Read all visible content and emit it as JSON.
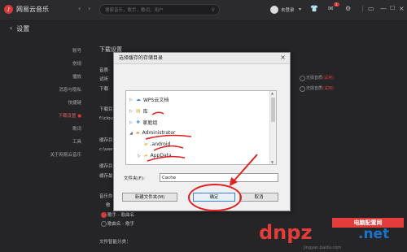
{
  "app": {
    "logo": "网易云音乐"
  },
  "header": {
    "search_placeholder": "搜索音乐，歌手，歌词，用户",
    "user": "未登录"
  },
  "page": {
    "title": "设置"
  },
  "sidebar": {
    "items": [
      {
        "label": "账号",
        "active": false
      },
      {
        "label": "常规",
        "active": false
      },
      {
        "label": "播放",
        "active": false
      },
      {
        "label": "消息与隐私",
        "active": false
      },
      {
        "label": "快捷键",
        "active": false
      },
      {
        "label": "下载设置",
        "active": true
      },
      {
        "label": "歌词",
        "active": false
      },
      {
        "label": "工具",
        "active": false
      },
      {
        "label": "关于网易云音乐",
        "active": false
      }
    ]
  },
  "main": {
    "section_title": "下载设置",
    "row1_label": "音质",
    "row1a": "试听",
    "row1b": "下载",
    "row2_label": "下载目",
    "row2_value": "f:\\clou",
    "row3_label": "缓存目",
    "row3_value": "c:\\use",
    "row4_label": "缓存目",
    "row4_value": "缓存最",
    "row5_label": "音乐命",
    "row5_value": "歌",
    "radio_opt_a": "歌手 - 歌曲名",
    "radio_opt_b": "歌曲名 - 歌手",
    "row6_label": "文件智能分类：",
    "right_note1": "无损音质",
    "right_link1": "(试用)",
    "right_note2": "无损音质",
    "right_link2": "(试用)"
  },
  "dialog": {
    "title": "选择缓存的存储目录",
    "tree": [
      {
        "label": "WPS云文档",
        "icon": "cloud-icon",
        "expander": "▷"
      },
      {
        "label": "库",
        "icon": "library-folder-icon",
        "expander": "▷"
      },
      {
        "label": "家庭组",
        "icon": "homegroup-icon",
        "expander": "▷"
      },
      {
        "label": "Administrator",
        "icon": "user-folder-icon",
        "expander": "◢"
      },
      {
        "label": ".android",
        "icon": "folder-icon",
        "expander": ""
      },
      {
        "label": "AppData",
        "icon": "folder-icon",
        "expander": "▷"
      }
    ],
    "folder_label": "文件夹(F):",
    "folder_value": "Cache",
    "new_folder_button": "新建文件夹(M)",
    "ok_button": "确定",
    "cancel_button": "取消"
  },
  "watermark": {
    "badge": "电脑配置网",
    "brand": "dnpz",
    "net": ".net",
    "bottom": "jingyan.baidu.com"
  },
  "colors": {
    "accent": "#d63a3a",
    "annotation": "#e02020",
    "background": "#252528"
  }
}
